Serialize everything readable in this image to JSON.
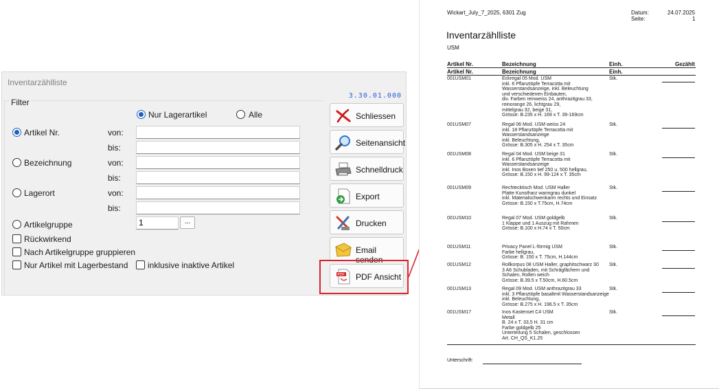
{
  "dialog": {
    "title": "Inventarzählliste",
    "version": "3.30.01.000",
    "filter_legend": "Filter",
    "options": {
      "nur_lager": "Nur Lagerartikel",
      "alle": "Alle"
    },
    "rows": {
      "artikel_nr": "Artikel Nr.",
      "bezeichnung": "Bezeichnung",
      "lagerort": "Lagerort",
      "artikelgruppe": "Artikelgruppe",
      "von": "von:",
      "bis": "bis:"
    },
    "artikelgruppe_value": "1",
    "dots": "...",
    "checks": {
      "rueckwirkend": "Rückwirkend",
      "gruppieren": "Nach Artikelgruppe gruppieren",
      "mit_lager": "Nur Artikel mit Lagerbestand",
      "inaktive": "inklusive inaktive Artikel"
    },
    "buttons": {
      "schliessen": "Schliessen",
      "seitenansicht": "Seitenansicht",
      "schnelldruck": "Schnelldruck",
      "export": "Export",
      "drucken": "Drucken",
      "email": "Email senden",
      "pdf": "PDF Ansicht"
    },
    "accent_color": "#1f5fbf",
    "highlight_color": "#d9232d"
  },
  "report": {
    "company": "Wickart_July_7_2025, 6301 Zug",
    "datum_label": "Datum:",
    "datum_value": "24.07.2025",
    "seite_label": "Seite:",
    "seite_value": "1",
    "title": "Inventarzählliste",
    "subtitle": "USM",
    "col_artikel": "Artikel Nr.",
    "col_bezeichnung": "Bezeichnung",
    "col_einh": "Einh.",
    "col_gezaehlt": "Gezählt",
    "items": [
      {
        "nr": "001USM01",
        "einh": "Stk.",
        "lines": [
          "Eckregal 05 Mod. USM",
          "inkl. 6 Pflanztöpfe Terracotta mit",
          "Wasserstandsanzeige, inkl. Beleuchtung",
          "und verschiedenen Einbauten,",
          "div. Farben reinweiss 24, anthrazitgrau 33,",
          "reinorange 26, lichtgrau 29,",
          "mittelgrau 32, beige 31,",
          "Grösse: B.235 x H. 169 x T. 39-169cm"
        ]
      },
      {
        "nr": "001USM07",
        "einh": "Stk.",
        "lines": [
          "Regal 06 Mod. USM weiss 24",
          "inkl. 18 Pflanztöpfe Terracotta mit",
          "Wasserstandsanzeige",
          "inkl. Beleuchtung,",
          "Grösse: B.305 x H. 254 x T. 35cm"
        ]
      },
      {
        "nr": "001USM08",
        "einh": "Stk.",
        "lines": [
          "Regal 04 Mod. USM beige 31",
          "inkl. 6 Pflanztöpfe Terracotta mit",
          "Wasserstandsanzeige",
          "inkl. Inos Boxen tief 250 u. 500 hellgrau,",
          "Grösse: B.150 x H. 99-124 x T. 35cm"
        ]
      },
      {
        "nr": "001USM09",
        "einh": "Stk.",
        "lines": [
          "Rechtecktisch Mod. USM Haller",
          "Platte Kunstharz warmgrau dunkel",
          "inkl. Materialschwenkarm rechts und Einsatz",
          "Grösse: B.150 x T.75cm, H.74cm"
        ]
      },
      {
        "nr": "001USM10",
        "einh": "Stk.",
        "lines": [
          "Regal 07 Mod. USM goldgelb",
          "1 Klappe und 1 Auszug mit Rahmen",
          "Grösse: B.100 x H.74 x T. 50cm"
        ]
      },
      {
        "nr": "001USM11",
        "einh": "Stk.",
        "lines": [
          "Privacy Panel L-förmig USM",
          "Farbe hellgrau,",
          "Grösse: B. 150 x T. 75cm, H.144cm"
        ]
      },
      {
        "nr": "001USM12",
        "einh": "Stk.",
        "lines": [
          "Rollkorpus 08 USM Haller, graphitschwarz 30",
          "3 A6 Schubladen, mit Schrägfächern und",
          "Schalen, Rollen weich",
          "Grösse: B.39.5 x T.50cm, H.60.5cm"
        ]
      },
      {
        "nr": "001USM13",
        "einh": "Stk.",
        "lines": [
          "Regal 09 Mod. USM anthrazitgrau 33",
          "inkl. 3 Pflanztöpfe basaltmit Wasserstandsanzeige",
          "inkl. Beleuchtung,",
          "Grösse: B.275 x H. 196.5 x T. 35cm"
        ]
      },
      {
        "nr": "001USM17",
        "einh": "Stk.",
        "lines": [
          "Inos Kastenset C4 USM",
          "Metall",
          "B. 24 x T. 33,5 H. 31 cm",
          "Farbe goldgelb 25",
          "Unterteilung 5 Schalen, geschlossen",
          "Art. CH_QS_K1.25"
        ]
      }
    ],
    "unterschrift": "Unterschrift:"
  }
}
